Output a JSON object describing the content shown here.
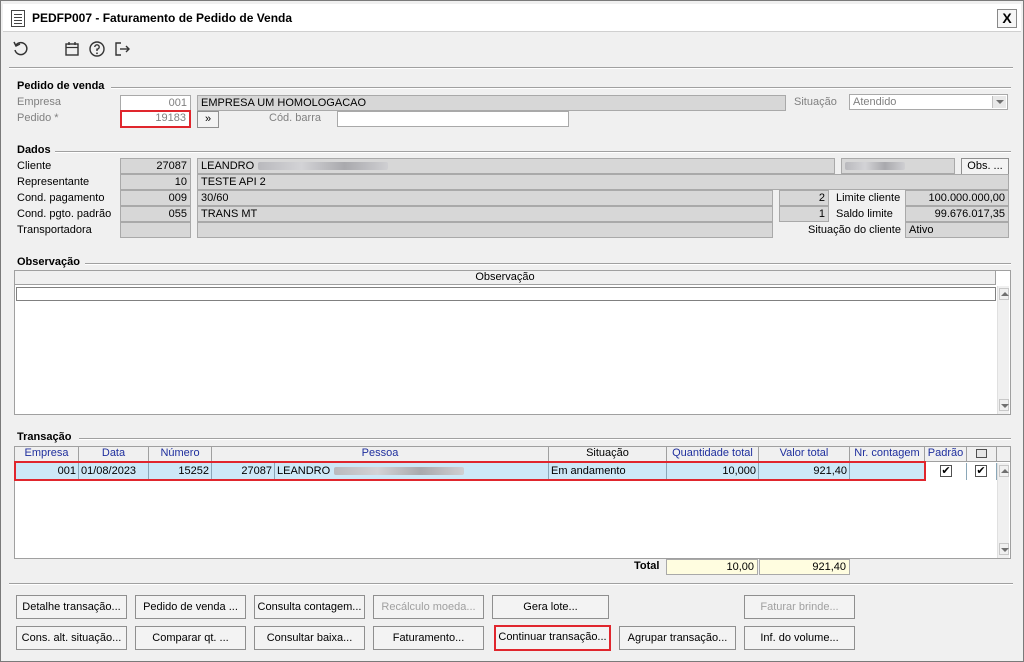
{
  "window": {
    "title": "PEDFP007 - Faturamento de Pedido de Venda",
    "close_label": "X"
  },
  "toolbar": {
    "icons": [
      "refresh-icon",
      "calendar-icon",
      "help-icon",
      "exit-icon"
    ]
  },
  "pedido": {
    "group_title": "Pedido de venda",
    "empresa_label": "Empresa",
    "empresa_code": "001",
    "empresa_name": "EMPRESA UM HOMOLOGACAO",
    "situacao_label": "Situação",
    "situacao_value": "Atendido",
    "pedido_label": "Pedido *",
    "pedido_value": "19183",
    "nav_button": "»",
    "cod_barra_label": "Cód. barra",
    "cod_barra_value": ""
  },
  "dados": {
    "group_title": "Dados",
    "cliente_label": "Cliente",
    "cliente_code": "27087",
    "cliente_name": "LEANDRO",
    "obs_button": "Obs. ...",
    "representante_label": "Representante",
    "representante_code": "10",
    "representante_name": "TESTE API 2",
    "cond_pag_label": "Cond. pagamento",
    "cond_pag_code": "009",
    "cond_pag_name": "30/60",
    "cond_pag_num": "2",
    "limite_label": "Limite cliente",
    "limite_value": "100.000.000,00",
    "cond_padrao_label": "Cond. pgto. padrão",
    "cond_padrao_code": "055",
    "cond_padrao_name": "TRANS MT",
    "cond_padrao_num": "1",
    "saldo_label": "Saldo limite",
    "saldo_value": "99.676.017,35",
    "transportadora_label": "Transportadora",
    "sit_cliente_label": "Situação do cliente",
    "sit_cliente_value": "Ativo"
  },
  "observacao": {
    "group_title": "Observação",
    "column_header": "Observação"
  },
  "transacao": {
    "group_title": "Transação",
    "columns": [
      "Empresa",
      "Data",
      "Número",
      "Pessoa",
      "Situação",
      "Quantidade total",
      "Valor total",
      "Nr. contagem",
      "Padrão"
    ],
    "rows": [
      {
        "empresa": "001",
        "data": "01/08/2023",
        "numero": "15252",
        "pessoa_code": "27087",
        "pessoa_name": "LEANDRO",
        "situacao": "Em andamento",
        "quantidade": "10,000",
        "valor": "921,40",
        "nr_contagem": "",
        "padrao": "✔",
        "selected": "✔"
      }
    ],
    "total_label": "Total",
    "total_quantidade": "10,00",
    "total_valor": "921,40"
  },
  "buttons": {
    "detalhe": "Detalhe transação...",
    "pedido": "Pedido de venda ...",
    "consulta_contagem": "Consulta contagem...",
    "recalculo": "Recálculo moeda...",
    "gera_lote": "Gera lote...",
    "faturar_brinde": "Faturar brinde...",
    "cons_alt": "Cons. alt. situação...",
    "comparar": "Comparar qt. ...",
    "consultar_baixa": "Consultar baixa...",
    "faturamento": "Faturamento...",
    "continuar": "Continuar transação...",
    "agrupar": "Agrupar transação...",
    "inf_volume": "Inf. do volume..."
  }
}
